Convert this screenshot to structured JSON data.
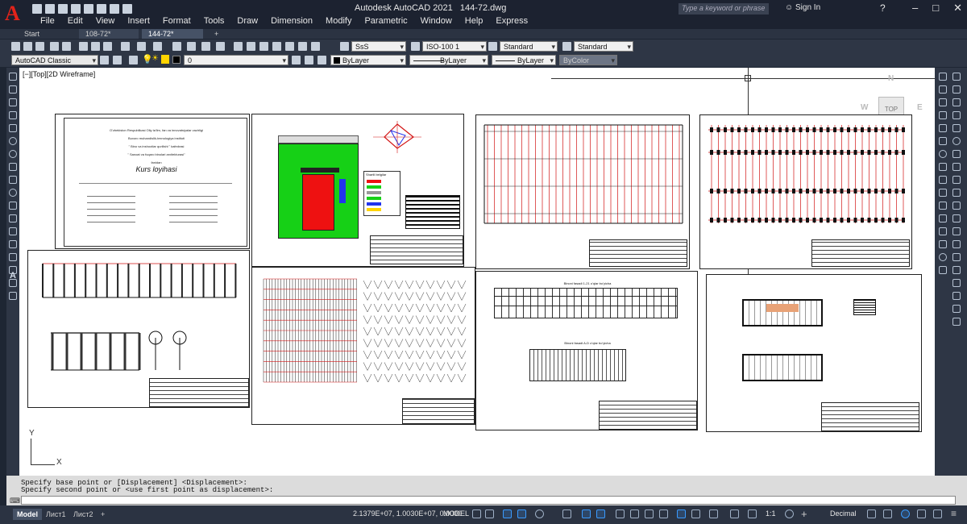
{
  "app": {
    "title": "Autodesk AutoCAD 2021",
    "file": "144-72.dwg",
    "logo": "A",
    "search_placeholder": "Type a keyword or phrase",
    "sign_in": "Sign In"
  },
  "menu": [
    "File",
    "Edit",
    "View",
    "Insert",
    "Format",
    "Tools",
    "Draw",
    "Dimension",
    "Modify",
    "Parametric",
    "Window",
    "Help",
    "Express"
  ],
  "tabs": [
    {
      "label": "Start"
    },
    {
      "label": "108-72*"
    },
    {
      "label": "144-72*"
    }
  ],
  "toolbar": {
    "text_style": "SsS",
    "dim_style": "ISO-100 1",
    "table_style": "Standard",
    "mleader_style": "Standard",
    "workspace": "AutoCAD Classic",
    "layer": "0",
    "color": "ByLayer",
    "linetype": "ByLayer",
    "lineweight": "ByLayer",
    "plot_style": "ByColor"
  },
  "viewport": {
    "label": "[−][Top][2D Wireframe]",
    "viewcube_top": "TOP",
    "compass_n": "N",
    "compass_w": "W",
    "compass_e": "E",
    "ucs_x": "X",
    "ucs_y": "Y"
  },
  "drawing_texts": {
    "cover_title": "Kurs loyihasi",
    "cover_lines": [
      "O'zbekiston Respublikasi Oliy ta'lim, fan va innovatsiyalar vazirligi",
      "Buxoro muhandislik-texnologiya instituti",
      "\" Bino va inshootlar qurilishi \" kafedrasi",
      "\" Sanoat va fuqaro binolari arxitekturasi\"",
      "fanidan"
    ],
    "explication_title": "Shartli belgilar",
    "facade_1": "Binoni fasadi 1-21 o’qlar bo’yicha",
    "facade_2": "Binoni fasadi A-D o’qlar bo’yicha"
  },
  "command": {
    "line1": "Specify base point or [Displacement] <Displacement>:",
    "line2": "Specify second point or <use first point as displacement>:"
  },
  "status": {
    "layout_tabs": [
      "Model",
      "Лист1",
      "Лист2"
    ],
    "coordinates": "2.1379E+07, 1.0030E+07, 0.0000",
    "space": "MODEL",
    "scale": "1:1",
    "units": "Decimal"
  },
  "colors": {
    "accent": "#3a9bff",
    "red_lines": "#d21414",
    "green_site": "#16d016",
    "title_bg": "#1c2230"
  },
  "icons": [
    "autocad-logo-icon",
    "new-icon",
    "open-icon",
    "save-icon",
    "print-icon",
    "undo-icon",
    "redo-icon",
    "search-icon",
    "user-icon",
    "help-icon",
    "minimize-icon",
    "maximize-icon",
    "close-icon"
  ]
}
